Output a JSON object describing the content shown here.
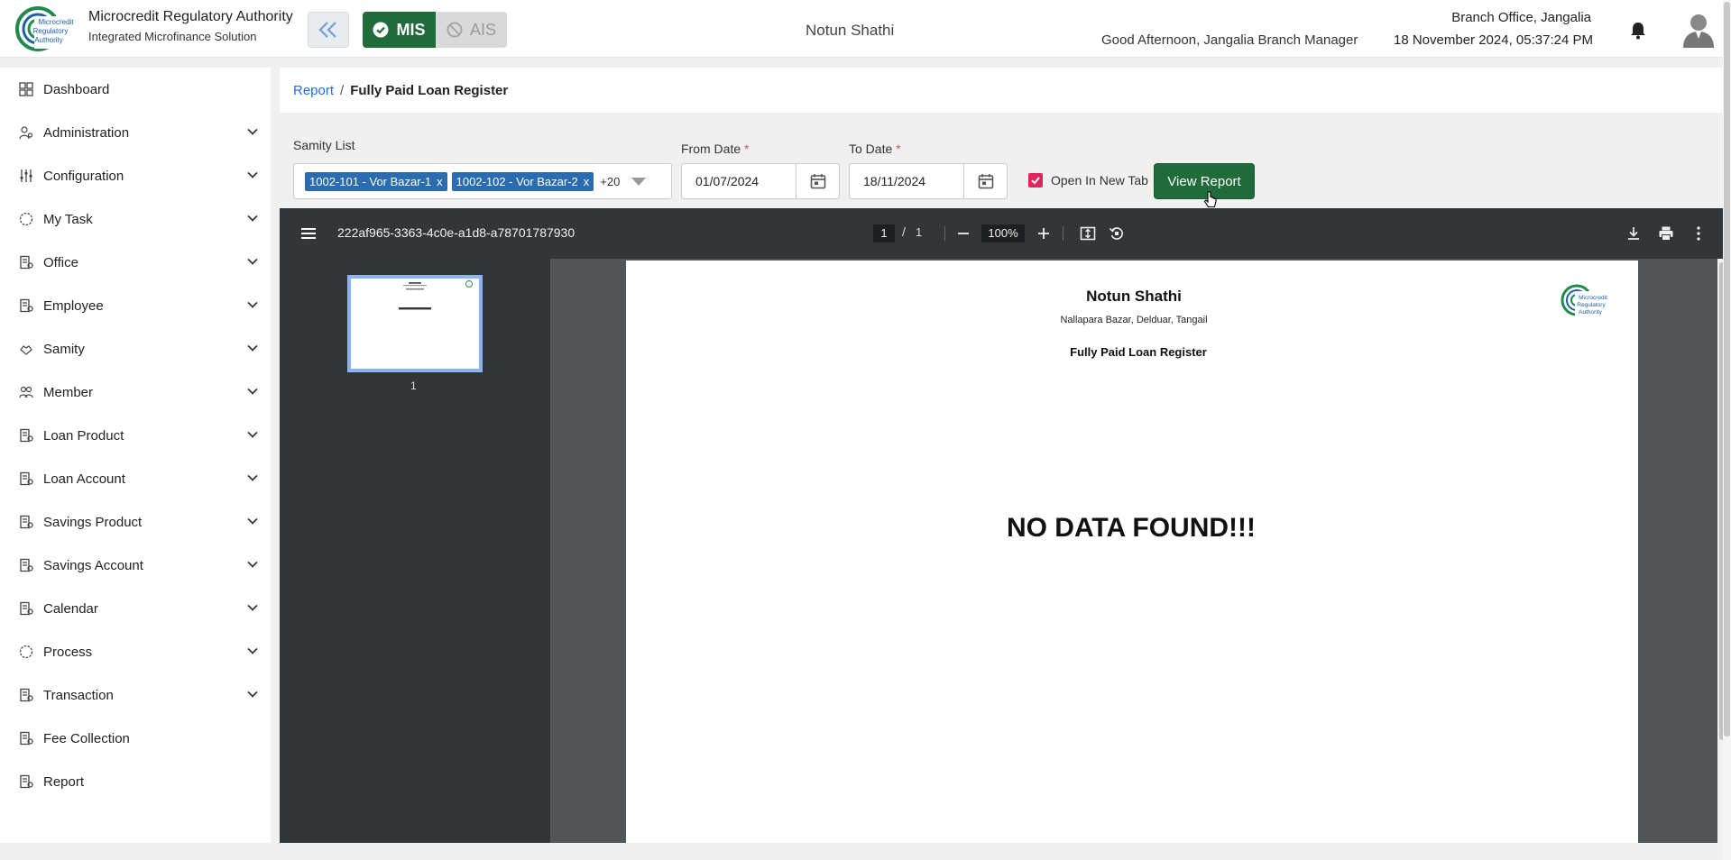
{
  "header": {
    "brand_title": "Microcredit Regulatory Authority",
    "brand_subtitle": "Integrated Microfinance Solution",
    "logo_text": "Microcredit Regulatory Authority",
    "mis_label": "MIS",
    "ais_label": "AIS",
    "organization": "Notun Shathi",
    "branch_office": "Branch Office, Jangalia",
    "greeting": "Good Afternoon, Jangalia Branch Manager",
    "datetime": "18 November 2024, 05:37:24 PM"
  },
  "sidebar": {
    "items": [
      {
        "label": "Dashboard",
        "icon": "dashboard-icon",
        "expandable": false
      },
      {
        "label": "Administration",
        "icon": "administration-icon",
        "expandable": true
      },
      {
        "label": "Configuration",
        "icon": "configuration-icon",
        "expandable": true
      },
      {
        "label": "My Task",
        "icon": "task-icon",
        "expandable": true
      },
      {
        "label": "Office",
        "icon": "office-icon",
        "expandable": true
      },
      {
        "label": "Employee",
        "icon": "employee-icon",
        "expandable": true
      },
      {
        "label": "Samity",
        "icon": "samity-icon",
        "expandable": true
      },
      {
        "label": "Member",
        "icon": "member-icon",
        "expandable": true
      },
      {
        "label": "Loan Product",
        "icon": "loan-product-icon",
        "expandable": true
      },
      {
        "label": "Loan Account",
        "icon": "loan-account-icon",
        "expandable": true
      },
      {
        "label": "Savings Product",
        "icon": "savings-product-icon",
        "expandable": true
      },
      {
        "label": "Savings Account",
        "icon": "savings-account-icon",
        "expandable": true
      },
      {
        "label": "Calendar",
        "icon": "calendar-icon",
        "expandable": true
      },
      {
        "label": "Process",
        "icon": "process-icon",
        "expandable": true
      },
      {
        "label": "Transaction",
        "icon": "transaction-icon",
        "expandable": true
      },
      {
        "label": "Fee Collection",
        "icon": "fee-collection-icon",
        "expandable": false
      },
      {
        "label": "Report",
        "icon": "report-icon",
        "expandable": false
      }
    ]
  },
  "breadcrumb": {
    "parent": "Report",
    "separator": "/",
    "current": "Fully Paid Loan Register"
  },
  "filters": {
    "samity_label": "Samity List",
    "samity_chips": [
      "1002-101 - Vor Bazar-1",
      "1002-102 - Vor Bazar-2"
    ],
    "chip_remove": "x",
    "samity_more": "+20",
    "from_label": "From Date",
    "from_value": "01/07/2024",
    "to_label": "To Date",
    "to_value": "18/11/2024",
    "required_mark": "*",
    "open_new_tab_label": "Open In New Tab",
    "open_new_tab_checked": true,
    "view_report_label": "View Report"
  },
  "pdf_viewer": {
    "file_name": "222af965-3363-4c0e-a1d8-a78701787930",
    "current_page": "1",
    "page_separator": "/",
    "total_pages": "1",
    "zoom": "100%",
    "thumbnail_number": "1",
    "document": {
      "organization": "Notun Shathi",
      "address": "Nallapara Bazar, Delduar, Tangail",
      "report_title": "Fully Paid Loan Register",
      "message": "NO DATA FOUND!!!"
    }
  },
  "colors": {
    "primary_green": "#1f6b3a",
    "chip_blue": "#2b6cb0",
    "link_blue": "#1a73e8",
    "checkbox_pink": "#e0245e",
    "pdf_toolbar": "#323639",
    "pdf_background": "#525659"
  }
}
